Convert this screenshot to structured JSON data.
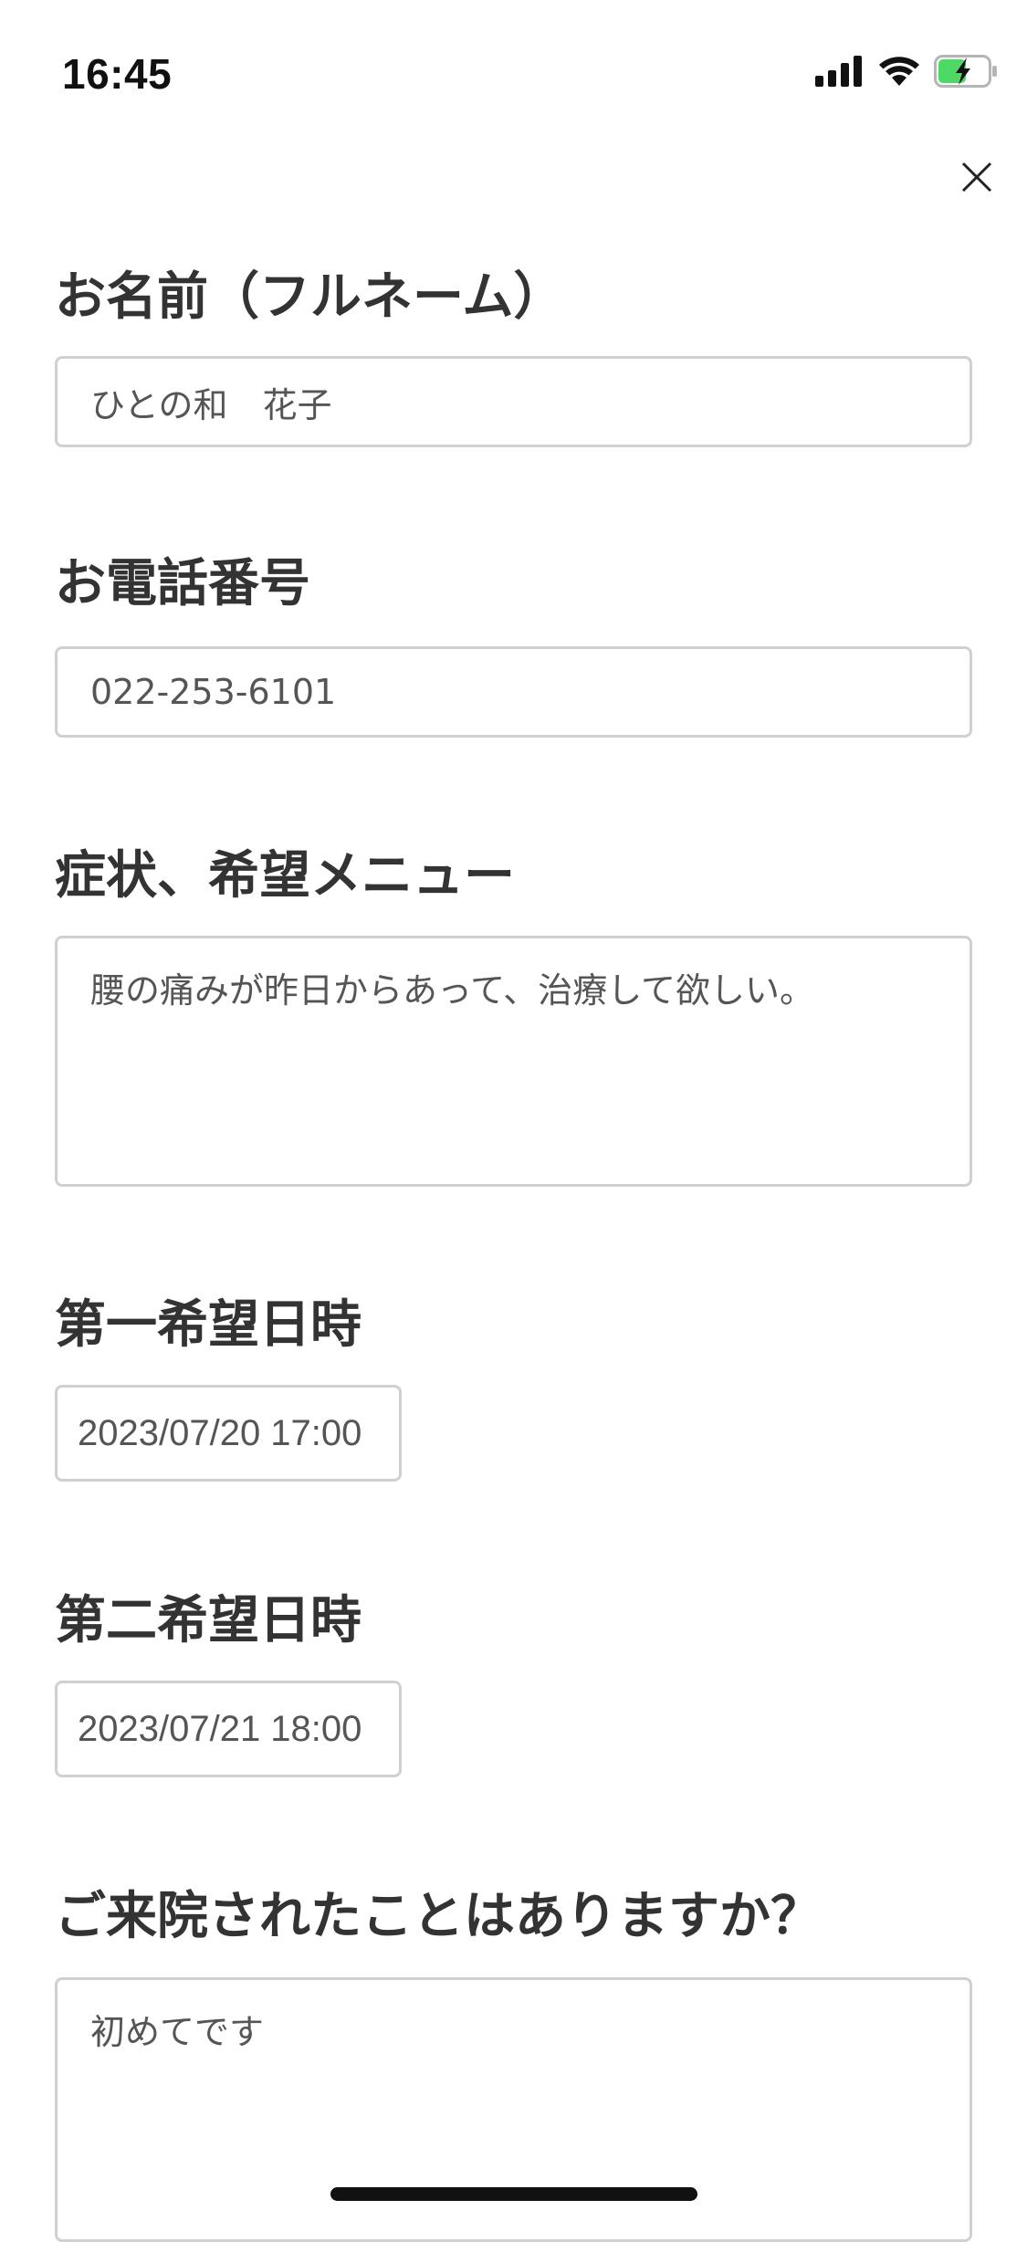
{
  "status_bar": {
    "time": "16:45",
    "icons": [
      "signal-icon",
      "wifi-icon",
      "battery-charging-icon"
    ],
    "battery_color": "#4cd964"
  },
  "close_icon": "close-icon",
  "form": {
    "name": {
      "label": "お名前（フルネーム）",
      "value": "ひとの和　花子"
    },
    "phone": {
      "label": "お電話番号",
      "value": "022-253-6101"
    },
    "symptoms": {
      "label": "症状、希望メニュー",
      "value": "腰の痛みが昨日からあって、治療して欲しい。"
    },
    "first_choice": {
      "label": "第一希望日時",
      "value": "2023/07/20 17:00"
    },
    "second_choice": {
      "label": "第二希望日時",
      "value": "2023/07/21 18:00"
    },
    "visited": {
      "label": "ご来院されたことはありますか？",
      "value": "初めてです"
    }
  }
}
